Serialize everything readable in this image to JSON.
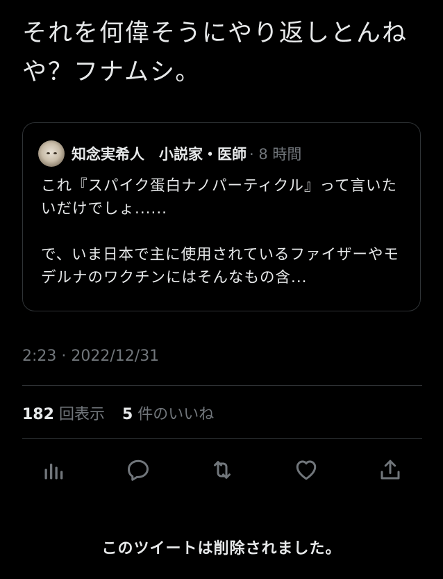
{
  "tweet": {
    "text": "それを何偉そうにやり返しとんねや？フナムシ。",
    "timestamp": "2:23 · 2022/12/31"
  },
  "quote": {
    "author": "知念実希人　小説家・医師",
    "age": "· 8 時間",
    "text": "これ『スパイク蛋白ナノパーティクル』って言いたいだけでしょ......\n\nで、いま日本で主に使用されているファイザーやモデルナのワクチンにはそんなもの含..."
  },
  "stats": {
    "views_count": "182",
    "views_label": "回表示",
    "likes_count": "5",
    "likes_label": "件のいいね"
  },
  "actions": [
    {
      "icon": "analytics-icon"
    },
    {
      "icon": "reply-icon"
    },
    {
      "icon": "retweet-icon"
    },
    {
      "icon": "like-icon"
    },
    {
      "icon": "share-icon"
    }
  ],
  "footer": {
    "deleted_notice": "このツイートは削除されました。"
  },
  "colors": {
    "background": "#000000",
    "text": "#e7e9ea",
    "secondary": "#71767b",
    "border": "#2f3336"
  }
}
